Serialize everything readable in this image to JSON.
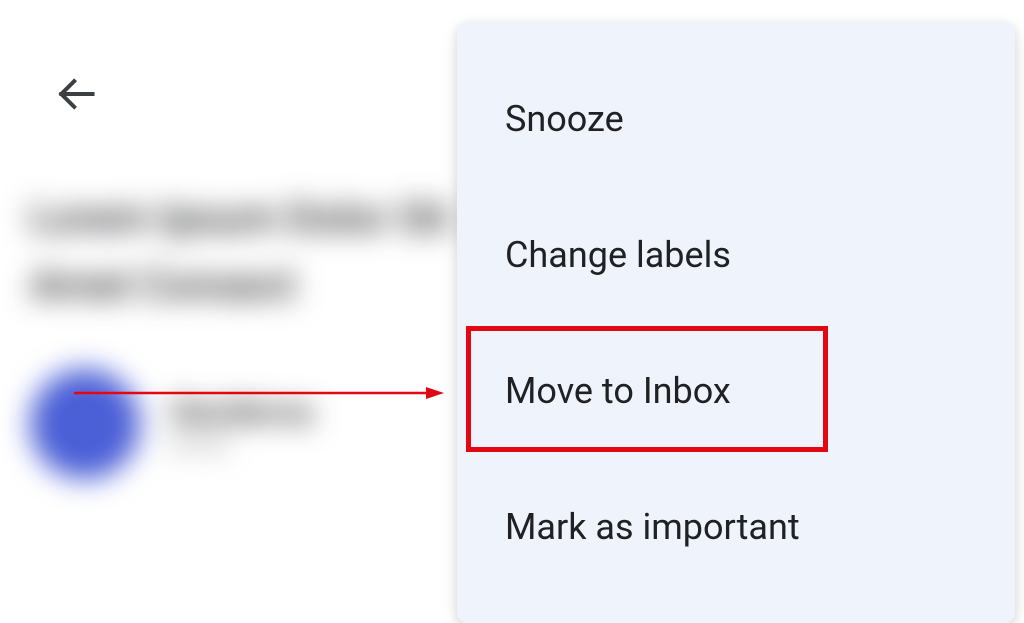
{
  "menu": {
    "items": [
      {
        "label": "Snooze"
      },
      {
        "label": "Change labels"
      },
      {
        "label": "Move to Inbox"
      },
      {
        "label": "Mark as important"
      }
    ]
  },
  "annotation": {
    "highlight_color": "#e30613",
    "arrow_color": "#e30613"
  }
}
